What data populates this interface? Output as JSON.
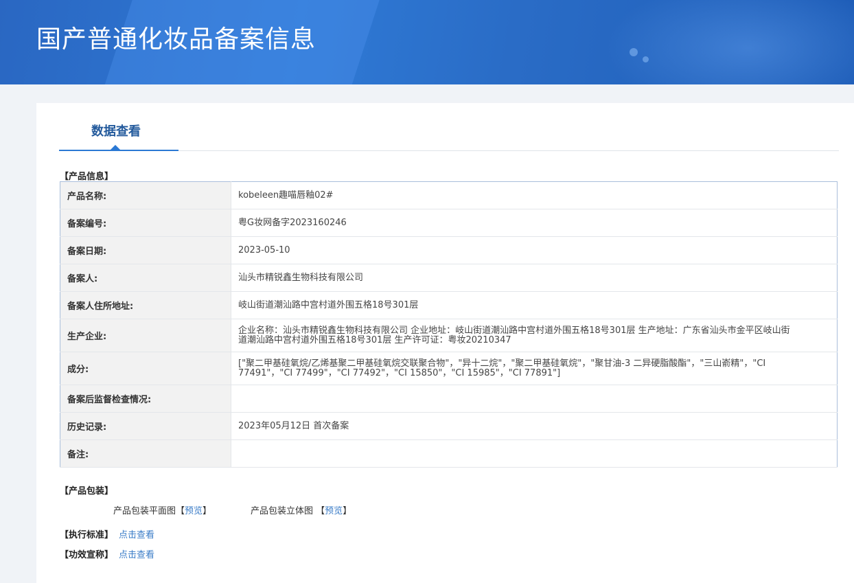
{
  "banner": {
    "title": "国产普通化妆品备案信息"
  },
  "tab": {
    "label": "数据查看"
  },
  "product_info": {
    "section_title": "【产品信息】",
    "rows": [
      {
        "label": "产品名称:",
        "value": "kobeleen趣喵唇釉02#"
      },
      {
        "label": "备案编号:",
        "value": "粤G妆网备字2023160246"
      },
      {
        "label": "备案日期:",
        "value": "2023-05-10"
      },
      {
        "label": "备案人:",
        "value": "汕头市精锐鑫生物科技有限公司"
      },
      {
        "label": "备案人住所地址:",
        "value": "岐山街道潮汕路中宫村道外围五格18号301层"
      },
      {
        "label": "生产企业:",
        "value": "企业名称：汕头市精锐鑫生物科技有限公司 企业地址：岐山街道潮汕路中宫村道外围五格18号301层 生产地址：广东省汕头市金平区岐山街道潮汕路中宫村道外围五格18号301层 生产许可证：粤妆20210347"
      },
      {
        "label": "成分:",
        "value": "[\"聚二甲基硅氧烷/乙烯基聚二甲基硅氧烷交联聚合物\"，\"异十二烷\"，\"聚二甲基硅氧烷\"，\"聚甘油-3 二异硬脂酸酯\"，\"三山嵛精\"，\"CI 77491\"，\"CI 77499\"，\"CI 77492\"，\"CI 15850\"，\"CI 15985\"，\"CI 77891\"]"
      },
      {
        "label": "备案后监督检查情况:",
        "value": ""
      },
      {
        "label": "历史记录:",
        "value": "2023年05月12日 首次备案"
      },
      {
        "label": "备注:",
        "value": ""
      }
    ]
  },
  "packaging": {
    "section_title": "【产品包装】",
    "flat_label": "产品包装平面图",
    "flat_link": "预览",
    "solid_label": "产品包装立体图",
    "solid_link": "预览",
    "bracket_open": "【",
    "bracket_close": "】"
  },
  "standard": {
    "label": "【执行标准】",
    "link": "点击查看"
  },
  "efficacy": {
    "label": "【功效宣称】",
    "link": "点击查看"
  }
}
